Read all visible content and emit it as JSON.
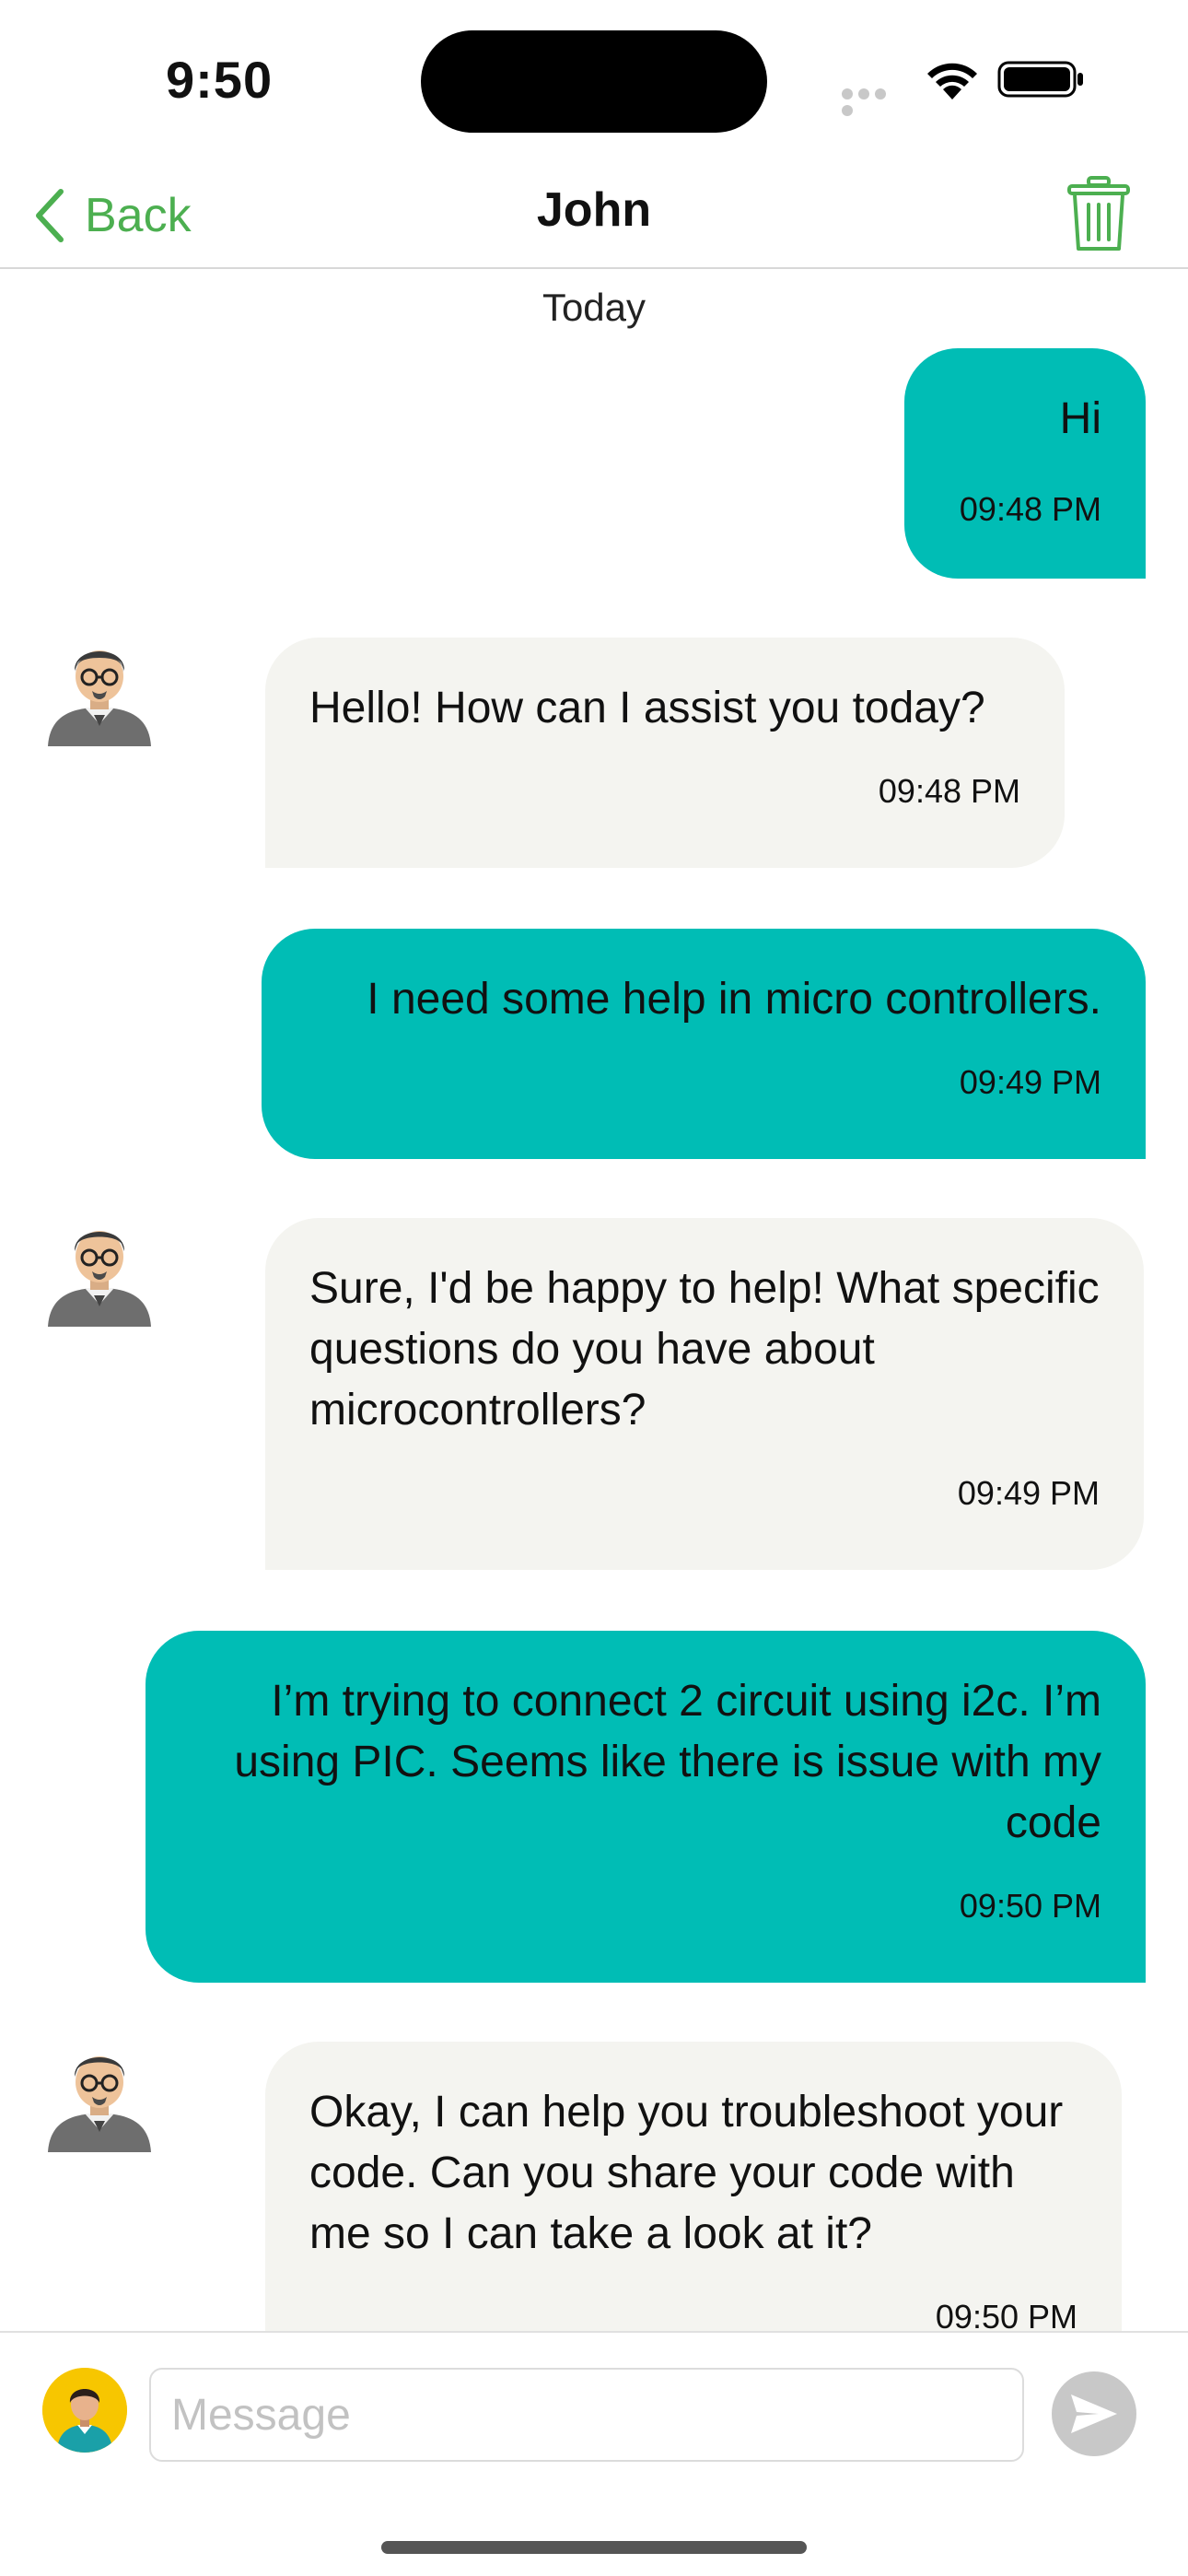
{
  "status_bar": {
    "time": "9:50"
  },
  "nav": {
    "back_label": "Back",
    "title": "John",
    "accent_color": "#4caf50"
  },
  "chat": {
    "date_label": "Today",
    "messages": [
      {
        "direction": "outgoing",
        "text": "Hi",
        "time": "09:48 PM"
      },
      {
        "direction": "incoming",
        "text": "Hello! How can I assist you today?",
        "time": "09:48 PM"
      },
      {
        "direction": "outgoing",
        "text": "I need some help in micro controllers.",
        "time": "09:49 PM"
      },
      {
        "direction": "incoming",
        "text": "Sure, I'd be happy to help! What specific questions do you have about microcontrollers?",
        "time": "09:49 PM"
      },
      {
        "direction": "outgoing",
        "text": "I’m trying to connect 2 circuit using i2c. I’m using PIC. Seems like there is issue with my code",
        "time": "09:50 PM"
      },
      {
        "direction": "incoming",
        "text": "Okay, I can help you troubleshoot your code. Can you share your code with me so I can take a look at it?",
        "time": "09:50 PM"
      }
    ],
    "outgoing_color": "#00bdb5",
    "incoming_color": "#f4f4f0"
  },
  "composer": {
    "placeholder": "Message",
    "value": ""
  },
  "icons": {
    "back": "chevron-left-icon",
    "delete": "trash-icon",
    "send": "paper-plane-icon",
    "contact_avatar": "person-with-glasses-avatar",
    "user_avatar": "user-avatar"
  }
}
